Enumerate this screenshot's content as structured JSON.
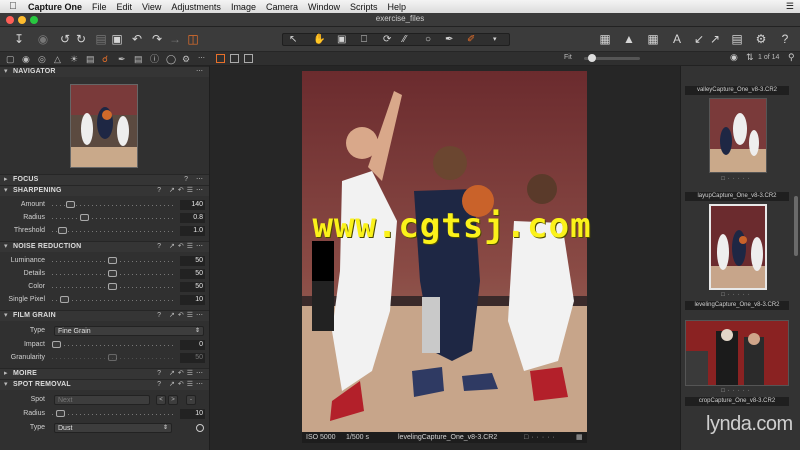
{
  "menubar": {
    "app_name": "Capture One",
    "items": [
      "File",
      "Edit",
      "View",
      "Adjustments",
      "Image",
      "Camera",
      "Window",
      "Scripts",
      "Help"
    ]
  },
  "window": {
    "title": "exercise_files"
  },
  "colors": {
    "close": "#ff5f57",
    "minimize": "#febc2e",
    "maximize": "#28c840",
    "accent": "#e8702a",
    "watermark": "#fbf21a"
  },
  "navigator": {
    "label": "NAVIGATOR"
  },
  "sections": {
    "focus": "FOCUS",
    "sharpening": "SHARPENING",
    "noise": "NOISE REDUCTION",
    "grain": "FILM GRAIN",
    "moire": "MOIRE",
    "spot": "SPOT REMOVAL"
  },
  "sharpening": {
    "amount": {
      "label": "Amount",
      "value": "140"
    },
    "radius": {
      "label": "Radius",
      "value": "0.8"
    },
    "threshold": {
      "label": "Threshold",
      "value": "1.0"
    }
  },
  "noise": {
    "luminance": {
      "label": "Luminance",
      "value": "50"
    },
    "details": {
      "label": "Details",
      "value": "50"
    },
    "color": {
      "label": "Color",
      "value": "50"
    },
    "single_pixel": {
      "label": "Single Pixel",
      "value": "10"
    }
  },
  "grain": {
    "type": {
      "label": "Type",
      "value": "Fine Grain"
    },
    "impact": {
      "label": "Impact",
      "value": "0"
    },
    "granularity": {
      "label": "Granularity",
      "value": "50"
    }
  },
  "spot": {
    "spot": {
      "label": "Spot",
      "value": "Next"
    },
    "radius": {
      "label": "Radius",
      "value": "10"
    },
    "type": {
      "label": "Type",
      "value": "Dust"
    }
  },
  "viewer": {
    "fit_label": "Fit",
    "iso": "ISO 5000",
    "shutter": "1/500 s",
    "filename": "levelingCapture_One_v8-3.CR2",
    "watermark": "www.cgtsj.com"
  },
  "browser": {
    "count": "1 of 14",
    "tiles": [
      {
        "caption": "valleyCapture_One_v8-3.CR2"
      },
      {
        "caption": "layupCapture_One_v8-3.CR2"
      },
      {
        "caption": "levelingCapture_One_v8-3.CR2"
      },
      {
        "caption": "cropCapture_One_v8-3.CR2"
      }
    ]
  },
  "branding": {
    "lynda": "lynda.com"
  }
}
